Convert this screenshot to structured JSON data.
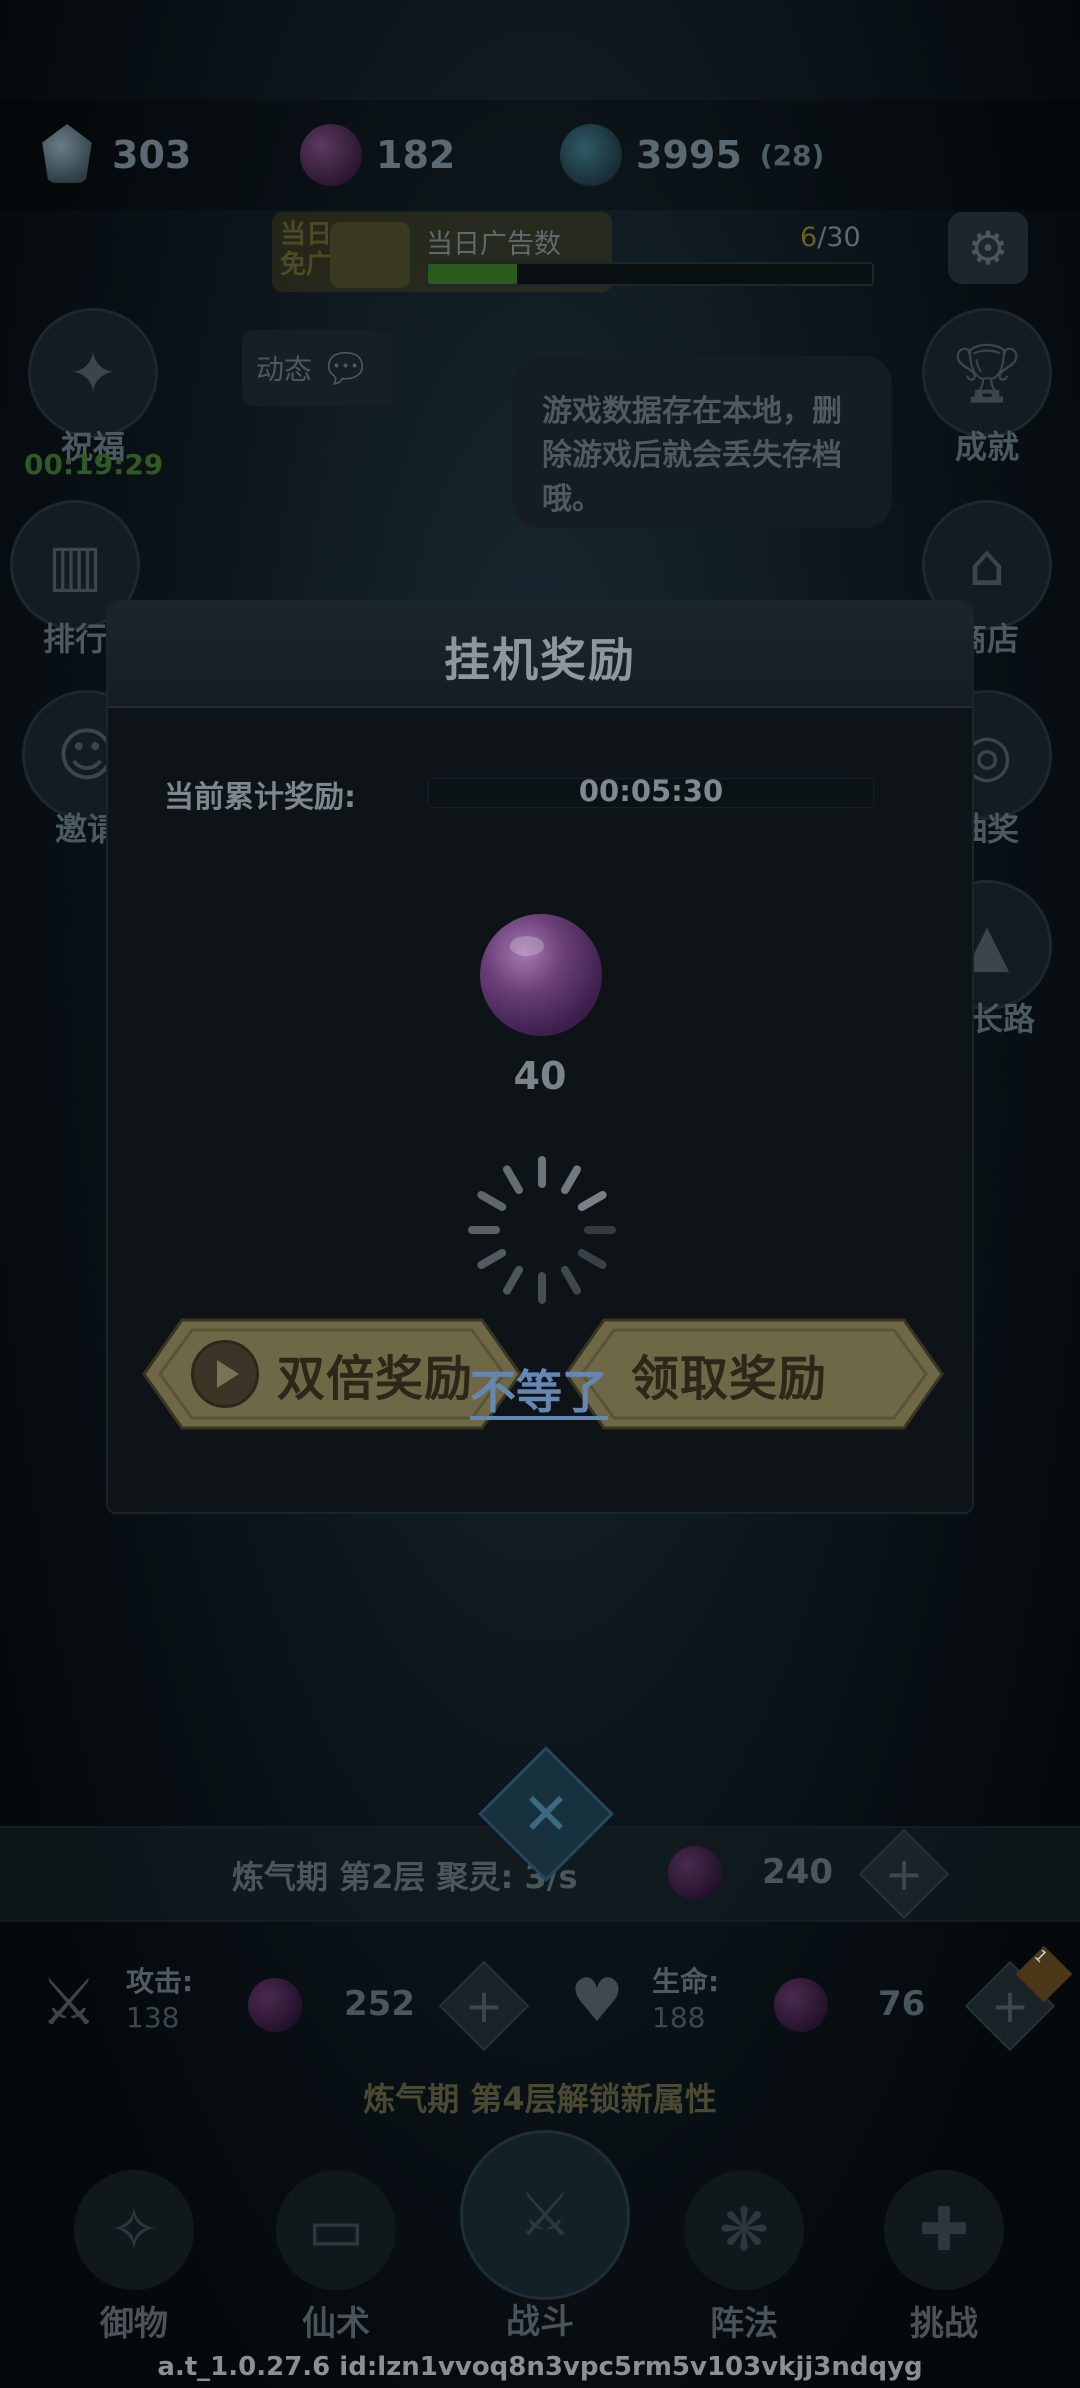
{
  "resources": {
    "crystal": {
      "value": "303",
      "icon": "crystal-icon"
    },
    "orb": {
      "value": "182",
      "icon": "purple-orb-icon"
    },
    "gem": {
      "value": "3995",
      "sub": "(28)",
      "icon": "gem-icon"
    }
  },
  "ad": {
    "badge": "当日免广",
    "title": "当日广告数",
    "count_current": "6",
    "count_total": "/30",
    "progress": 0.2
  },
  "left_menu": [
    {
      "label": "祝福",
      "icon": "blessing-icon"
    },
    {
      "label": "排行",
      "icon": "ranking-icon"
    },
    {
      "label": "邀请",
      "icon": "invite-icon"
    }
  ],
  "blessing_timer": "00:19:29",
  "right_menu": [
    {
      "label": "成就",
      "icon": "trophy-icon"
    },
    {
      "label": "商店",
      "icon": "shop-icon"
    },
    {
      "label": "抽奖",
      "icon": "lottery-icon"
    },
    {
      "label": "成长路",
      "icon": "growth-icon"
    }
  ],
  "dynamic_label": "动态",
  "tip_bubble": "游戏数据存在本地，删除游戏后就会丢失存档哦。",
  "modal": {
    "title": "挂机奖励",
    "accumulated_label": "当前累计奖励:",
    "elapsed": "00:05:30",
    "reward_amount": "40",
    "double_button": "双倍奖励",
    "wait_link": "不等了",
    "claim_button": "领取奖励"
  },
  "realm": {
    "text": "炼气期 第2层 聚灵: 3/s",
    "cost": "240"
  },
  "stats": {
    "attack_label": "攻击:",
    "attack_value": "138",
    "attack_cost": "252",
    "hp_label": "生命:",
    "hp_value": "188",
    "hp_cost": "76",
    "badge": "1"
  },
  "unlock_hint": "炼气期 第4层解锁新属性",
  "bottom_nav": [
    {
      "label": "御物",
      "icon": "artifact-icon"
    },
    {
      "label": "仙术",
      "icon": "spell-card-icon"
    },
    {
      "label": "战斗",
      "icon": "battle-swords-icon"
    },
    {
      "label": "阵法",
      "icon": "formation-icon"
    },
    {
      "label": "挑战",
      "icon": "challenge-icon"
    }
  ],
  "version": "a.t_1.0.27.6 id:lzn1vvoq8n3vpc5rm5v103vkjj3ndqyg",
  "colors": {
    "button_gold": "#6f6847",
    "link_blue": "#6488b3",
    "orb_purple": "#6a3f78"
  }
}
